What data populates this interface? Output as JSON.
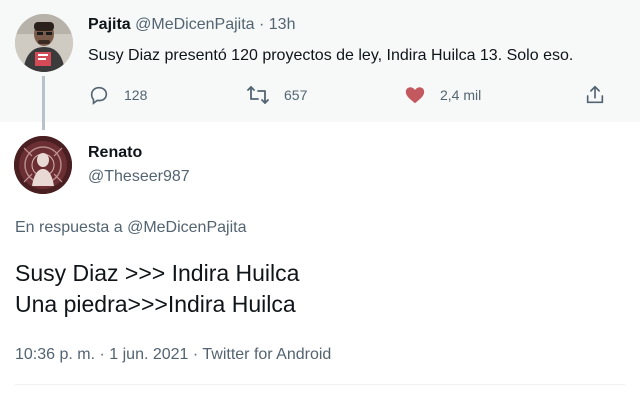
{
  "parent_tweet": {
    "author_name": "Pajita",
    "author_handle": "@MeDicenPajita",
    "separator": " · ",
    "time": "13h",
    "text": "Susy Diaz presentó 120 proyectos de ley, Indira Huilca 13. Solo eso.",
    "replies": "128",
    "retweets": "657",
    "likes": "2,4 mil",
    "icons": {
      "reply": "reply-icon",
      "retweet": "retweet-icon",
      "like": "heart-icon",
      "share": "share-icon"
    },
    "like_color": "#c3585f"
  },
  "main_tweet": {
    "author_name": "Renato",
    "author_handle": "@Theseer987",
    "reply_prefix": "En respuesta a ",
    "reply_mention": "@MeDicenPajita",
    "text_lines": [
      "Susy Diaz >>> Indira Huilca",
      "Una piedra>>>Indira Huilca"
    ],
    "timestamp": "10:36 p. m. · 1 jun. 2021 · Twitter for Android"
  }
}
